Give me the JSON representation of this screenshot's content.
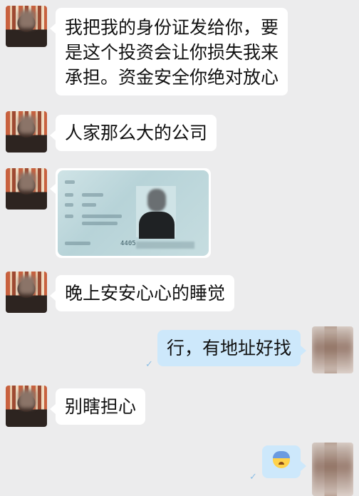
{
  "messages": [
    {
      "side": "left",
      "lines": [
        "我把我的身份证发给你，要",
        "是这个投资会让你损失我来",
        "承担。资金安全你绝对放心"
      ]
    },
    {
      "side": "left",
      "lines": [
        "人家那么大的公司"
      ]
    },
    {
      "side": "left",
      "type": "image",
      "image_number_text": "4405"
    },
    {
      "side": "left",
      "lines": [
        "晚上安安心心的睡觉"
      ]
    },
    {
      "side": "right",
      "lines": [
        "行，有地址好找"
      ]
    },
    {
      "side": "left",
      "lines": [
        "别瞎担心"
      ]
    },
    {
      "side": "right",
      "type": "emoji",
      "emoji": "anxious-sweat-emoji"
    }
  ],
  "read_mark": "✓",
  "colors": {
    "background": "#ececed",
    "left_bubble": "#ffffff",
    "right_bubble": "#cde8fb"
  }
}
